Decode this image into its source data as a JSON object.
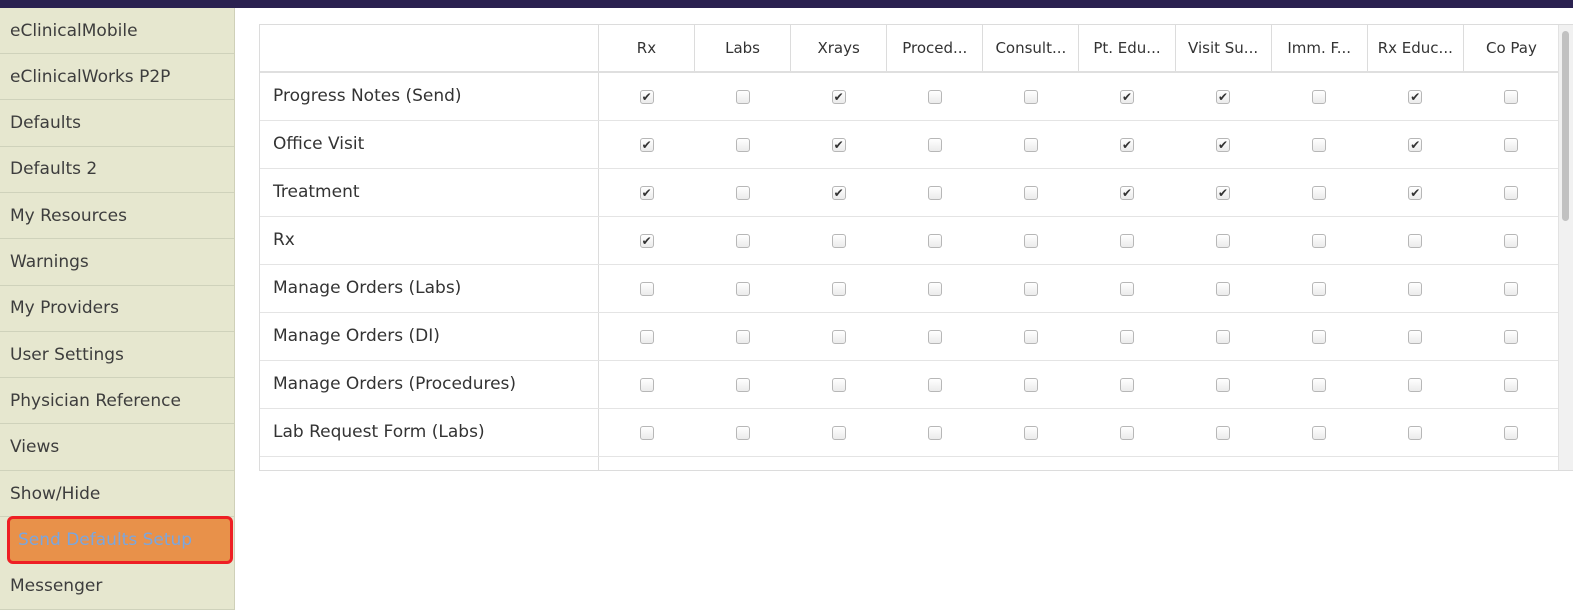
{
  "sidebar": {
    "items": [
      {
        "label": "eClinicalMobile"
      },
      {
        "label": "eClinicalWorks P2P"
      },
      {
        "label": "Defaults"
      },
      {
        "label": "Defaults 2"
      },
      {
        "label": "My Resources"
      },
      {
        "label": "Warnings"
      },
      {
        "label": "My Providers"
      },
      {
        "label": "User Settings"
      },
      {
        "label": "Physician Reference"
      },
      {
        "label": "Views"
      },
      {
        "label": "Show/Hide"
      },
      {
        "label": "Send Defaults Setup",
        "active": true
      },
      {
        "label": "Messenger"
      }
    ]
  },
  "grid": {
    "columns": [
      "Rx",
      "Labs",
      "Xrays",
      "Proced...",
      "Consult...",
      "Pt. Edu...",
      "Visit Su...",
      "Imm. F...",
      "Rx Educ...",
      "Co Pay"
    ],
    "rows": [
      {
        "label": "Progress Notes (Send)",
        "checks": [
          true,
          false,
          true,
          false,
          false,
          true,
          true,
          false,
          true,
          false
        ]
      },
      {
        "label": "Office Visit",
        "checks": [
          true,
          false,
          true,
          false,
          false,
          true,
          true,
          false,
          true,
          false
        ]
      },
      {
        "label": "Treatment",
        "checks": [
          true,
          false,
          true,
          false,
          false,
          true,
          true,
          false,
          true,
          false
        ]
      },
      {
        "label": "Rx",
        "checks": [
          true,
          false,
          false,
          false,
          false,
          false,
          false,
          false,
          false,
          false
        ]
      },
      {
        "label": "Manage Orders (Labs)",
        "checks": [
          false,
          false,
          false,
          false,
          false,
          false,
          false,
          false,
          false,
          false
        ]
      },
      {
        "label": "Manage Orders (DI)",
        "checks": [
          false,
          false,
          false,
          false,
          false,
          false,
          false,
          false,
          false,
          false
        ]
      },
      {
        "label": "Manage Orders (Procedures)",
        "checks": [
          false,
          false,
          false,
          false,
          false,
          false,
          false,
          false,
          false,
          false
        ]
      },
      {
        "label": "Lab Request Form (Labs)",
        "checks": [
          false,
          false,
          false,
          false,
          false,
          false,
          false,
          false,
          false,
          false
        ]
      }
    ]
  },
  "colors": {
    "active_bg": "#e8914a",
    "active_border": "#ee1f24",
    "active_text": "#7aa6de",
    "sidebar_bg": "#e6e7cf"
  }
}
